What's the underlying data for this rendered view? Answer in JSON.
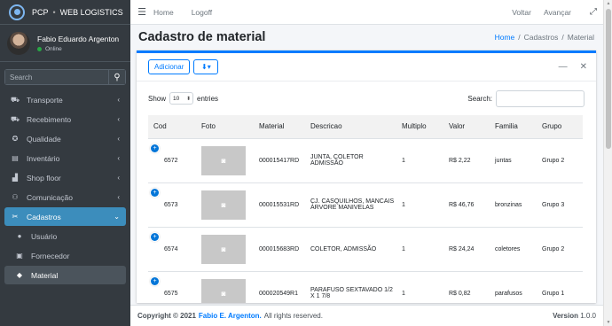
{
  "brand": {
    "name": "PCP",
    "sub": "WEB LOGISTICS"
  },
  "user": {
    "name": "Fabio Eduardo Argenton",
    "status": "Online"
  },
  "sidebar_search": {
    "placeholder": "Search"
  },
  "nav": [
    {
      "label": "Transporte",
      "icon": "truck-icon",
      "glyph": "⛟"
    },
    {
      "label": "Recebimento",
      "icon": "truck-loading-icon",
      "glyph": "⛟"
    },
    {
      "label": "Qualidade",
      "icon": "award-icon",
      "glyph": "✪"
    },
    {
      "label": "Inventário",
      "icon": "chart-icon",
      "glyph": "▤"
    },
    {
      "label": "Shop floor",
      "icon": "industry-icon",
      "glyph": "▟"
    },
    {
      "label": "Comunicação",
      "icon": "people-icon",
      "glyph": "⚇"
    },
    {
      "label": "Cadastros",
      "icon": "tools-icon",
      "glyph": "✂"
    },
    {
      "label": "Usuário",
      "icon": "user-icon",
      "glyph": "●"
    },
    {
      "label": "Fornecedor",
      "icon": "address-card-icon",
      "glyph": "▣"
    },
    {
      "label": "Material",
      "icon": "box-icon",
      "glyph": "◆"
    }
  ],
  "topbar": {
    "home": "Home",
    "logoff": "Logoff",
    "back": "Voltar",
    "forward": "Avançar"
  },
  "page": {
    "title": "Cadastro de material"
  },
  "breadcrumb": {
    "home": "Home",
    "cadastros": "Cadastros",
    "material": "Material"
  },
  "card": {
    "add_label": "Adicionar",
    "export_icon": "download-icon"
  },
  "datatable": {
    "show_label": "Show",
    "length_value": "10",
    "entries_label": "entries",
    "search_label": "Search:",
    "columns": [
      "Cod",
      "Foto",
      "Material",
      "Descricao",
      "Multiplo",
      "Valor",
      "Familia",
      "Grupo"
    ],
    "rows": [
      {
        "cod": "6572",
        "material": "000015417RD",
        "descricao": "JUNTA, COLETOR ADMISSÃO",
        "multiplo": "1",
        "valor": "R$ 2,22",
        "familia": "juntas",
        "grupo": "Grupo 2"
      },
      {
        "cod": "6573",
        "material": "000015531RD",
        "descricao": "CJ. CASQUILHOS, MANCAIS ÁRVORE MANIVELAS",
        "multiplo": "1",
        "valor": "R$ 46,76",
        "familia": "bronzinas",
        "grupo": "Grupo 3"
      },
      {
        "cod": "6574",
        "material": "000015683RD",
        "descricao": "COLETOR, ADMISSÃO",
        "multiplo": "1",
        "valor": "R$ 24,24",
        "familia": "coletores",
        "grupo": "Grupo 2"
      },
      {
        "cod": "6575",
        "material": "000020549R1",
        "descricao": "PARAFUSO SEXTAVADO 1/2 X 1 7/8",
        "multiplo": "1",
        "valor": "R$ 0,82",
        "familia": "parafusos",
        "grupo": "Grupo 1"
      }
    ]
  },
  "footer": {
    "copyright": "Copyright © 2021",
    "author": "Fabio E. Argenton.",
    "rights": "All rights reserved.",
    "version_label": "Version",
    "version": "1.0.0"
  }
}
